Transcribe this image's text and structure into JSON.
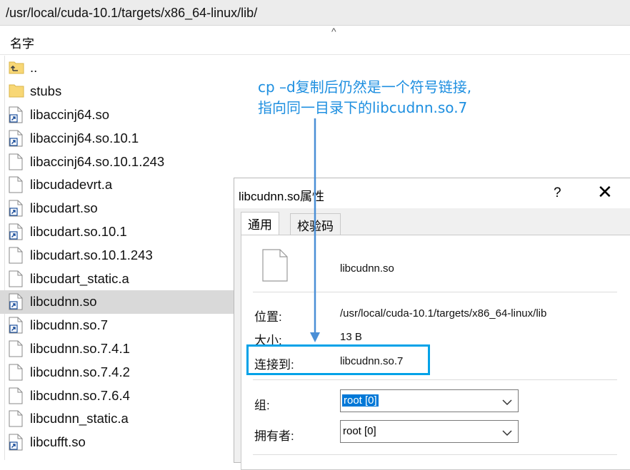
{
  "path_bar": {
    "path": "/usr/local/cuda-10.1/targets/x86_64-linux/lib/"
  },
  "column_header": {
    "name": "名字",
    "sort_indicator": "^"
  },
  "files": [
    {
      "name": "..",
      "icon": "folder-up"
    },
    {
      "name": "stubs",
      "icon": "folder"
    },
    {
      "name": "libaccinj64.so",
      "icon": "shortcut"
    },
    {
      "name": "libaccinj64.so.10.1",
      "icon": "shortcut"
    },
    {
      "name": "libaccinj64.so.10.1.243",
      "icon": "file"
    },
    {
      "name": "libcudadevrt.a",
      "icon": "file"
    },
    {
      "name": "libcudart.so",
      "icon": "shortcut"
    },
    {
      "name": "libcudart.so.10.1",
      "icon": "shortcut"
    },
    {
      "name": "libcudart.so.10.1.243",
      "icon": "file"
    },
    {
      "name": "libcudart_static.a",
      "icon": "file"
    },
    {
      "name": "libcudnn.so",
      "icon": "shortcut",
      "selected": true
    },
    {
      "name": "libcudnn.so.7",
      "icon": "shortcut"
    },
    {
      "name": "libcudnn.so.7.4.1",
      "icon": "file"
    },
    {
      "name": "libcudnn.so.7.4.2",
      "icon": "file"
    },
    {
      "name": "libcudnn.so.7.6.4",
      "icon": "file"
    },
    {
      "name": "libcudnn_static.a",
      "icon": "file"
    },
    {
      "name": "libcufft.so",
      "icon": "shortcut"
    }
  ],
  "annotation": {
    "line1": "cp –d复制后仍然是一个符号链接,",
    "line2": "指向同一目录下的libcudnn.so.7",
    "color": "#1e8fe0"
  },
  "dialog": {
    "title": "libcudnn.so属性",
    "help": "?",
    "close": "✕",
    "tabs": [
      "通用",
      "校验码"
    ],
    "file_name": "libcudnn.so",
    "location_label": "位置:",
    "location_value": "/usr/local/cuda-10.1/targets/x86_64-linux/lib",
    "size_label": "大小:",
    "size_value": "13 B",
    "link_label": "连接到:",
    "link_value": "libcudnn.so.7",
    "group_label": "组:",
    "group_value": "root [0]",
    "owner_label": "拥有者:",
    "owner_value": "root [0]",
    "highlight_color": "#00a2e8"
  }
}
